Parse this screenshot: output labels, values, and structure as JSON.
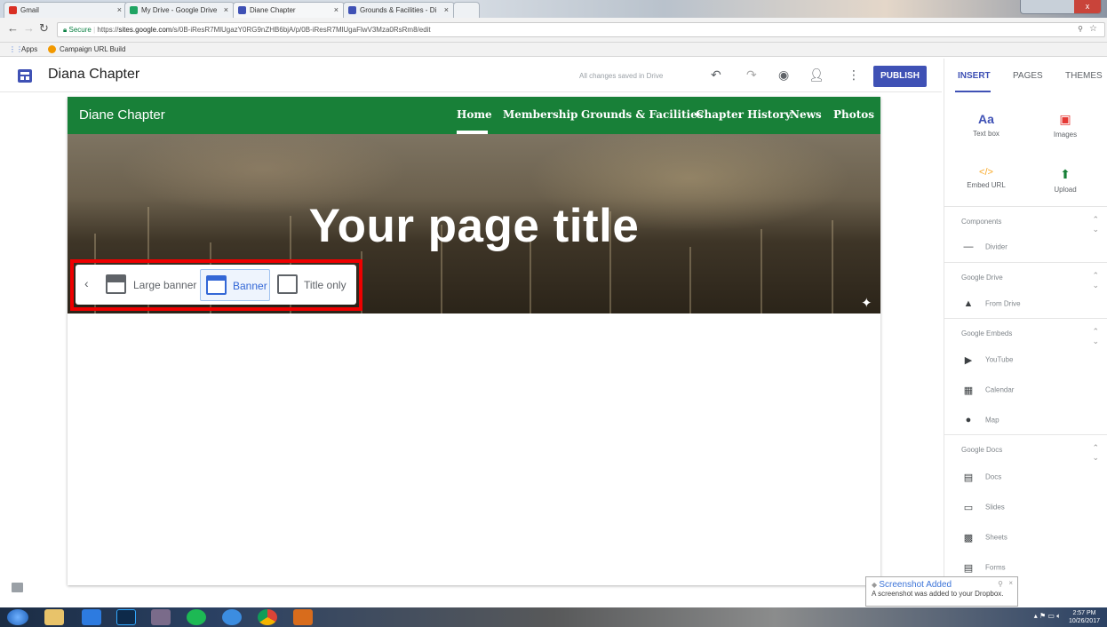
{
  "browser": {
    "tabs": [
      {
        "label": "Gmail",
        "fav_color": "#d93025"
      },
      {
        "label": "My Drive - Google Drive",
        "fav_color": "#1fa463"
      },
      {
        "label": "Diane Chapter",
        "fav_color": "#3f51b5"
      },
      {
        "label": "Grounds & Facilities - Di",
        "fav_color": "#3f51b5"
      }
    ],
    "window_close": "x",
    "url_secure": "Secure",
    "url_prefix": "https://",
    "url_host": "sites.google.com",
    "url_path": "/s/0B-iResR7MlUgazY0RG9nZHB6bjA/p/0B-iResR7MlUgaFlwV3Mza0RsRm8/edit",
    "bookmarks": [
      "Apps",
      "Campaign URL Build"
    ]
  },
  "header": {
    "site_name": "Diana Chapter",
    "save_status": "All changes saved in Drive",
    "publish": "PUBLISH"
  },
  "site": {
    "brand": "Diane Chapter",
    "nav": [
      "Home",
      "Membership",
      "Grounds & Facilities",
      "Chapter History",
      "News",
      "Photos"
    ],
    "page_title": "Your page title",
    "layouts": [
      "Large banner",
      "Banner",
      "Title only"
    ]
  },
  "panel": {
    "tabs": [
      "INSERT",
      "PAGES",
      "THEMES"
    ],
    "tiles": [
      {
        "icon": "Aa",
        "label": "Text box",
        "color": "#3f51b5"
      },
      {
        "icon": "▣",
        "label": "Images",
        "color": "#e53935"
      },
      {
        "icon": "</>",
        "label": "Embed URL",
        "color": "#f9a825"
      },
      {
        "icon": "⬆",
        "label": "Upload",
        "color": "#188038"
      }
    ],
    "sections": {
      "components": "Components",
      "drive": "Google Drive",
      "embeds": "Google Embeds",
      "docs": "Google Docs"
    },
    "items": {
      "divider": "Divider",
      "from_drive": "From Drive",
      "youtube": "YouTube",
      "calendar": "Calendar",
      "map": "Map",
      "docs": "Docs",
      "slides": "Slides",
      "sheets": "Sheets",
      "forms": "Forms"
    }
  },
  "toast": {
    "title": "Screenshot Added",
    "body": "A screenshot was added to your Dropbox."
  },
  "taskbar": {
    "time": "2:57 PM",
    "date": "10/26/2017"
  }
}
